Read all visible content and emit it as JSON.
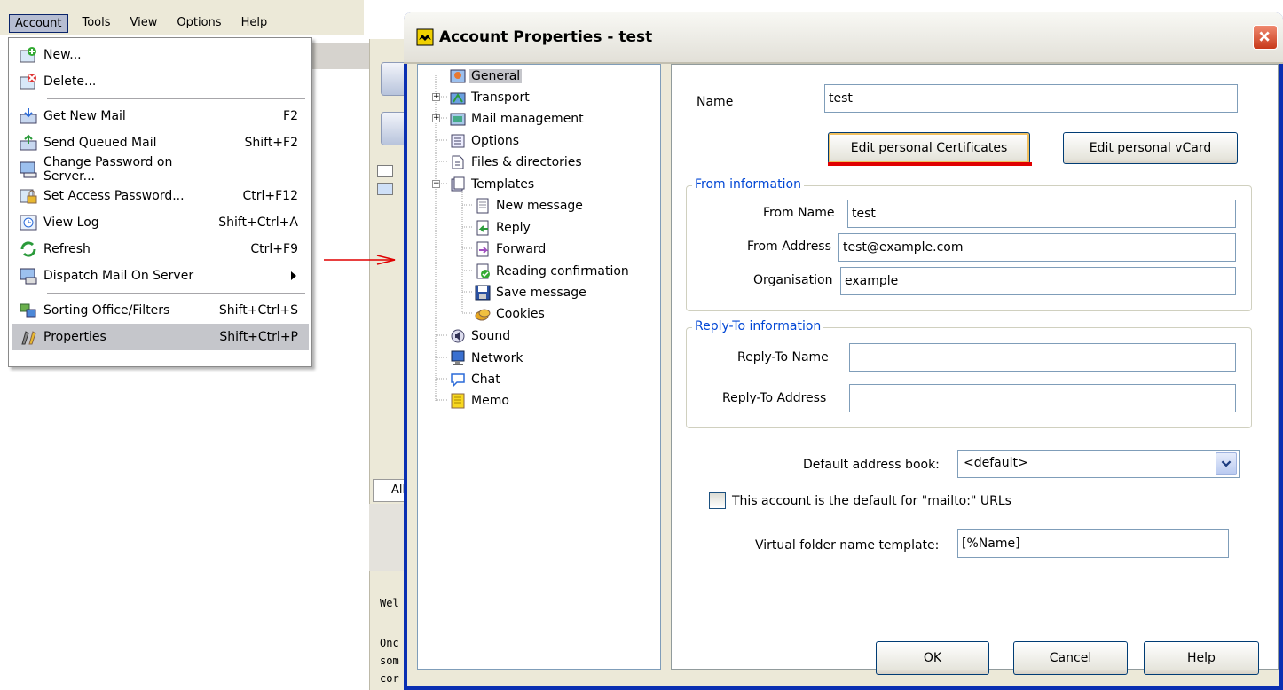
{
  "menubar": {
    "items": [
      "Account",
      "Tools",
      "View",
      "Options",
      "Help"
    ]
  },
  "account_menu": {
    "items": [
      {
        "label": "New...",
        "shortcut": "",
        "icon": "new-account-icon"
      },
      {
        "label": "Delete...",
        "shortcut": "",
        "icon": "delete-account-icon"
      },
      {
        "label": "Get New Mail",
        "shortcut": "F2",
        "icon": "get-mail-icon"
      },
      {
        "label": "Send Queued Mail",
        "shortcut": "Shift+F2",
        "icon": "send-mail-icon"
      },
      {
        "label": "Change Password on Server...",
        "shortcut": "",
        "icon": "password-server-icon"
      },
      {
        "label": "Set Access Password...",
        "shortcut": "Ctrl+F12",
        "icon": "lock-icon"
      },
      {
        "label": "View Log",
        "shortcut": "Shift+Ctrl+A",
        "icon": "log-icon"
      },
      {
        "label": "Refresh",
        "shortcut": "Ctrl+F9",
        "icon": "refresh-icon"
      },
      {
        "label": "Dispatch Mail On Server",
        "shortcut": "",
        "icon": "dispatch-icon"
      },
      {
        "label": "Sorting Office/Filters",
        "shortcut": "Shift+Ctrl+S",
        "icon": "filters-icon"
      },
      {
        "label": "Properties",
        "shortcut": "Shift+Ctrl+P",
        "icon": "properties-icon"
      }
    ]
  },
  "background": {
    "tab_all": "All",
    "text_lines": [
      "Wel",
      "Onc",
      "som",
      "cor"
    ]
  },
  "dialog": {
    "title": "Account Properties - test",
    "tree": [
      {
        "label": "General"
      },
      {
        "label": "Transport"
      },
      {
        "label": "Mail management"
      },
      {
        "label": "Options"
      },
      {
        "label": "Files & directories"
      },
      {
        "label": "Templates"
      },
      {
        "label": "New message"
      },
      {
        "label": "Reply"
      },
      {
        "label": "Forward"
      },
      {
        "label": "Reading confirmation"
      },
      {
        "label": "Save message"
      },
      {
        "label": "Cookies"
      },
      {
        "label": "Sound"
      },
      {
        "label": "Network"
      },
      {
        "label": "Chat"
      },
      {
        "label": "Memo"
      }
    ],
    "general": {
      "name_label": "Name",
      "name_value": "test",
      "edit_certificates": "Edit personal Certificates",
      "edit_vcard": "Edit personal vCard",
      "from_group": "From information",
      "from_name_label": "From Name",
      "from_name_value": "test",
      "from_address_label": "From Address",
      "from_address_value": "test@example.com",
      "organisation_label": "Organisation",
      "organisation_value": "example",
      "reply_group": "Reply-To information",
      "reply_name_label": "Reply-To Name",
      "reply_name_value": "",
      "reply_address_label": "Reply-To Address",
      "reply_address_value": "",
      "address_book_label": "Default address book:",
      "address_book_value": "<default>",
      "mailto_checkbox": "This account is the default for \"mailto:\" URLs",
      "virtual_folder_label": "Virtual folder name template:",
      "virtual_folder_value": "[%Name]"
    },
    "buttons": {
      "ok": "OK",
      "cancel": "Cancel",
      "help": "Help"
    }
  },
  "colors": {
    "xp_blue": "#0a2fb2",
    "highlight": "#c5c6cb",
    "group_title": "#0046d5",
    "red_marker": "#e00000"
  }
}
